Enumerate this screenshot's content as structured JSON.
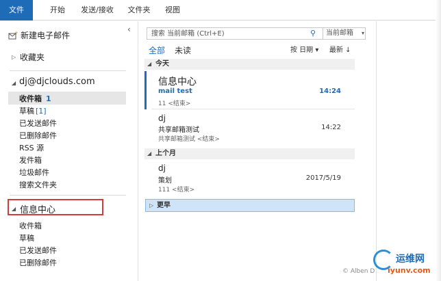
{
  "ribbon": {
    "tabs": [
      {
        "label": "文件"
      },
      {
        "label": "开始"
      },
      {
        "label": "发送/接收"
      },
      {
        "label": "文件夹"
      },
      {
        "label": "视图"
      }
    ]
  },
  "nav": {
    "new_mail": "新建电子邮件",
    "favorites": "收藏夹",
    "account": "dj@djclouds.com",
    "account_folders": {
      "inbox": "收件箱",
      "inbox_count": "1",
      "drafts": "草稿",
      "drafts_count": "[1]",
      "sent": "已发送邮件",
      "deleted": "已删除邮件",
      "rss": "RSS 源",
      "outbox": "发件箱",
      "junk": "垃圾邮件",
      "search": "搜索文件夹"
    },
    "group2": "信息中心",
    "group2_folders": [
      "收件箱",
      "草稿",
      "已发送邮件",
      "已删除邮件"
    ]
  },
  "list": {
    "search_placeholder": "搜索 当前邮箱 (Ctrl+E)",
    "search_scope": "当前邮箱",
    "filter_all": "全部",
    "filter_unread": "未读",
    "sort_by": "按 日期",
    "sort_order": "最新 ↓",
    "groups": {
      "today": "今天",
      "last_month": "上个月",
      "older": "更早"
    },
    "mails": [
      {
        "sender": "信息中心",
        "subject": "mail test",
        "preview": "11 <结束>",
        "time": "14:24"
      },
      {
        "sender": "dj",
        "subject": "共享邮箱测试",
        "preview": "共享邮箱测试 <结束>",
        "time": "14:22"
      },
      {
        "sender": "dj",
        "subject": "策划",
        "preview": "111 <结束>",
        "time": "2017/5/19"
      }
    ]
  },
  "watermark": {
    "site": "运维网",
    "domain": "iyunv.com",
    "copyright": "© Alben D"
  }
}
